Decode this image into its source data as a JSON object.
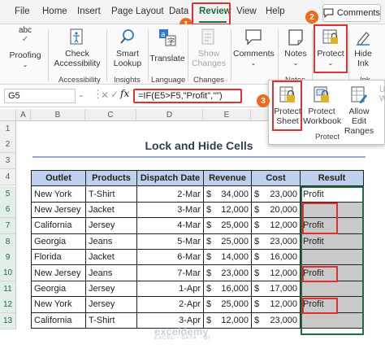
{
  "tabs": [
    "File",
    "Home",
    "Insert",
    "Page Layout",
    "Data",
    "Review",
    "View",
    "Help"
  ],
  "active_tab": "Review",
  "comments_button": "Comments",
  "ribbon": {
    "proofing": "Proofing",
    "check_accessibility": [
      "Check",
      "Accessibility"
    ],
    "accessibility_group": "Accessibility",
    "smart_lookup": [
      "Smart",
      "Lookup"
    ],
    "insights_group": "Insights",
    "translate": "Translate",
    "language_group": "Language",
    "show_changes": [
      "Show",
      "Changes"
    ],
    "changes_group": "Changes",
    "comments": "Comments",
    "notes": "Notes",
    "notes_group": "Notes",
    "protect": "Protect",
    "hide_ink": [
      "Hide",
      "Ink"
    ],
    "ink_group": "Ink"
  },
  "popup": {
    "protect_sheet": [
      "Protect",
      "Sheet"
    ],
    "protect_workbook": [
      "Protect",
      "Workbook"
    ],
    "allow_edit_ranges": [
      "Allow Edit",
      "Ranges"
    ],
    "group": "Protect"
  },
  "badges": [
    "1",
    "2",
    "3"
  ],
  "namebox": "G5",
  "fx": "fx",
  "formula": "=IF(E5>F5,\"Profit\",\"\")",
  "columns": [
    "A",
    "B",
    "C",
    "D",
    "E",
    "F",
    "G"
  ],
  "rows": [
    "1",
    "2",
    "3",
    "4",
    "5",
    "6",
    "7",
    "8",
    "9",
    "10",
    "11",
    "12",
    "13"
  ],
  "sheet_title": "Lock and Hide Cells",
  "table": {
    "headers": [
      "Outlet",
      "Products",
      "Dispatch Date",
      "Revenue",
      "Cost",
      "Result"
    ],
    "rows": [
      [
        "New York",
        "T-Shirt",
        "2-Mar",
        "34,000",
        "23,000",
        "Profit"
      ],
      [
        "New Jersey",
        "Jacket",
        "3-Mar",
        "12,000",
        "20,000",
        ""
      ],
      [
        "California",
        "Jersey",
        "4-Mar",
        "25,000",
        "12,000",
        "Profit"
      ],
      [
        "Georgia",
        "Jeans",
        "5-Mar",
        "25,000",
        "23,000",
        "Profit"
      ],
      [
        "Florida",
        "Jacket",
        "6-Mar",
        "14,000",
        "16,000",
        ""
      ],
      [
        "New Jersey",
        "Jeans",
        "7-Mar",
        "23,000",
        "12,000",
        "Profit"
      ],
      [
        "Georgia",
        "Jersey",
        "1-Apr",
        "16,000",
        "17,000",
        ""
      ],
      [
        "New York",
        "Jersey",
        "2-Apr",
        "25,000",
        "12,000",
        "Profit"
      ],
      [
        "California",
        "T-Shirt",
        "3-Apr",
        "12,000",
        "23,000",
        ""
      ]
    ],
    "currency": "$"
  },
  "watermark": [
    "exceldemy",
    "EXCEL · DATA · BI"
  ],
  "colors": {
    "excel_green": "#217346",
    "highlight_red": "#e03131",
    "badge_orange": "#ec6b1c",
    "header_blue": "#bfd0ec"
  }
}
